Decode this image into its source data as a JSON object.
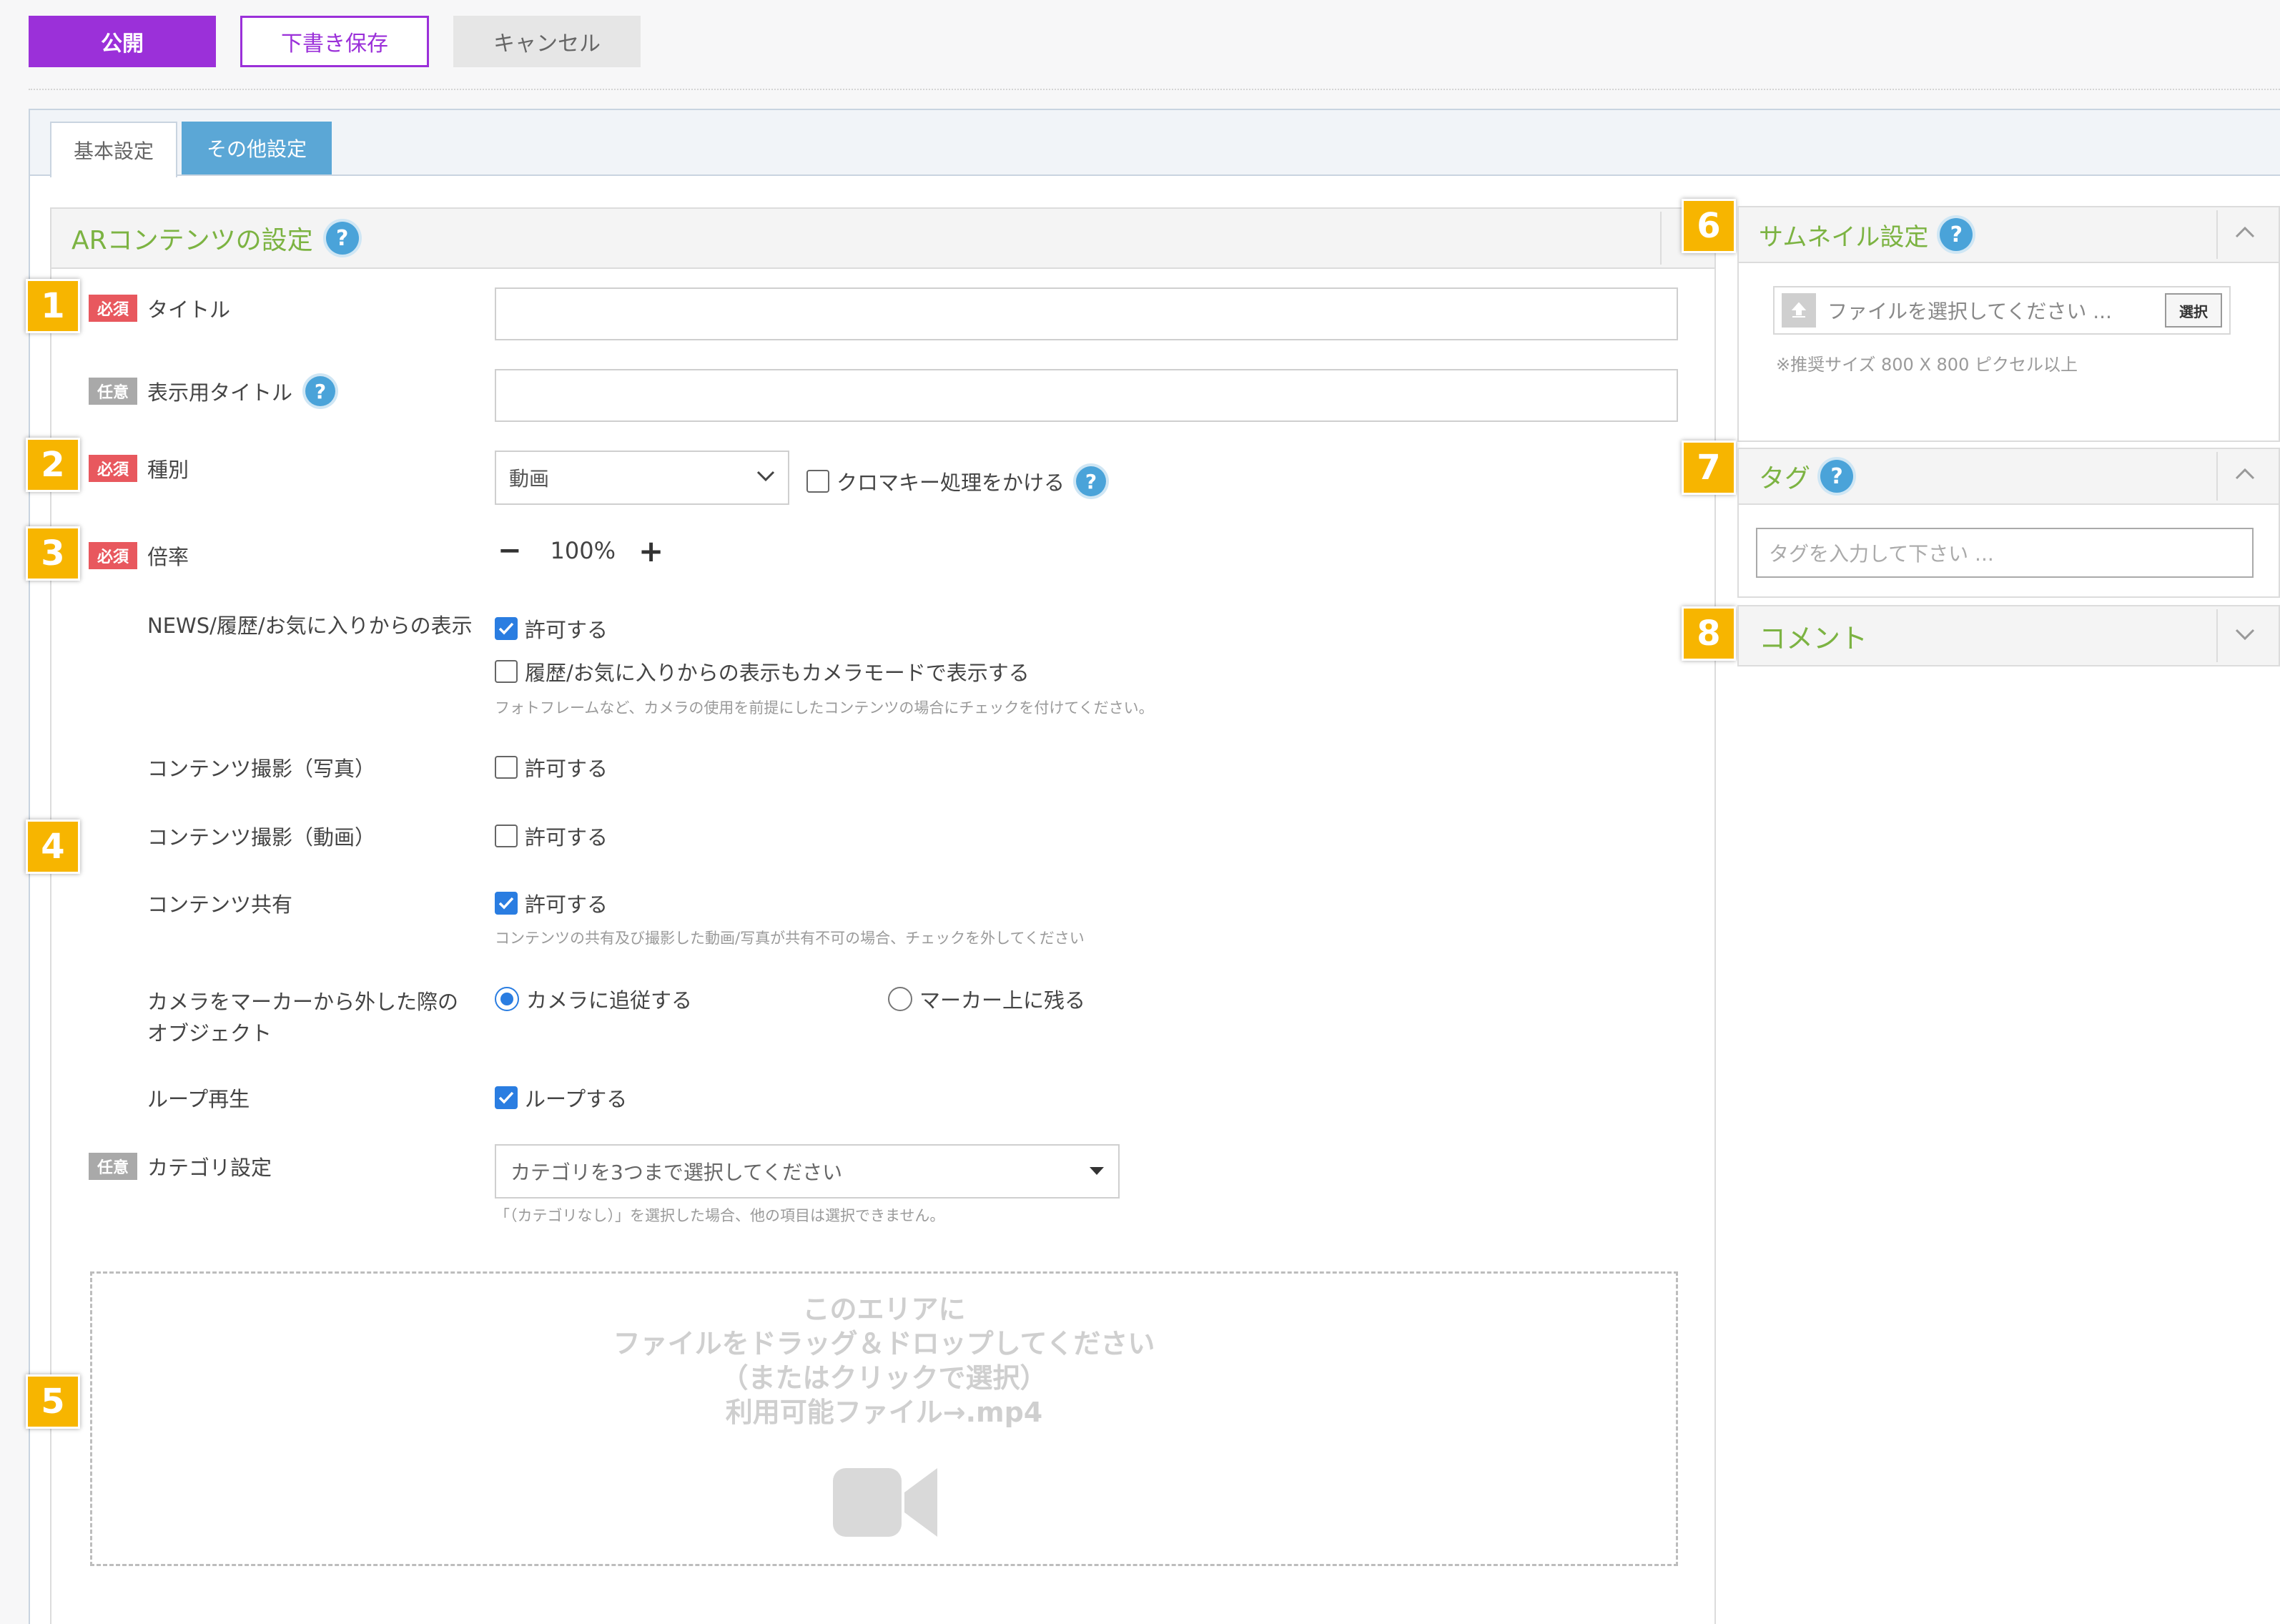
{
  "toolbar": {
    "publish_label": "公開",
    "draft_label": "下書き保存",
    "cancel_label": "キャンセル"
  },
  "tabs": [
    {
      "label": "基本設定",
      "active": true
    },
    {
      "label": "その他設定",
      "active": false
    }
  ],
  "main_panel": {
    "title": "ARコンテンツの設定",
    "help": "?"
  },
  "badges": {
    "required": "必須",
    "optional": "任意"
  },
  "markers": [
    "1",
    "2",
    "3",
    "4",
    "5",
    "6",
    "7",
    "8"
  ],
  "form": {
    "title_label": "タイトル",
    "title_value": "",
    "display_title_label": "表示用タイトル",
    "display_title_value": "",
    "type_label": "種別",
    "type_selected": "動画",
    "chroma_label": "クロマキー処理をかける",
    "chroma_checked": false,
    "scale_label": "倍率",
    "scale_minus": "−",
    "scale_value": "100%",
    "scale_plus": "+",
    "news_label": "NEWS/履歴/お気に入りからの表示",
    "news_allow_label": "許可する",
    "news_allow_checked": true,
    "news_camera_label": "履歴/お気に入りからの表示もカメラモードで表示する",
    "news_camera_checked": false,
    "news_note": "フォトフレームなど、カメラの使用を前提にしたコンテンツの場合にチェックを付けてください。",
    "photo_label": "コンテンツ撮影（写真）",
    "photo_allow_label": "許可する",
    "photo_checked": false,
    "video_label": "コンテンツ撮影（動画）",
    "video_allow_label": "許可する",
    "video_checked": false,
    "share_label": "コンテンツ共有",
    "share_allow_label": "許可する",
    "share_checked": true,
    "share_note": "コンテンツの共有及び撮影した動画/写真が共有不可の場合、チェックを外してください",
    "camera_label_line1": "カメラをマーカーから外した際の",
    "camera_label_line2": "オブジェクト",
    "camera_follow_label": "カメラに追従する",
    "camera_stay_label": "マーカー上に残る",
    "camera_selected": "follow",
    "loop_label": "ループ再生",
    "loop_option_label": "ループする",
    "loop_checked": true,
    "category_label": "カテゴリ設定",
    "category_placeholder": "カテゴリを3つまで選択してください",
    "category_note": "「（カテゴリなし）」を選択した場合、他の項目は選択できません。"
  },
  "dropzone": {
    "line1": "このエリアに",
    "line2": "ファイルをドラッグ＆ドロップしてください",
    "line3": "（またはクリックで選択）",
    "line4": "利用可能ファイル→.mp4",
    "icon": "video-camera-icon"
  },
  "sidebar": {
    "thumbnail": {
      "title": "サムネイル設定",
      "file_placeholder": "ファイルを選択してください ...",
      "select_button": "選択",
      "note": "※推奨サイズ 800 X 800 ピクセル以上",
      "collapsed": false
    },
    "tag": {
      "title": "タグ",
      "input_placeholder": "タグを入力して下さい ...",
      "collapsed": false
    },
    "comment": {
      "title": "コメント",
      "collapsed": true
    }
  },
  "colors": {
    "publish": "#9b30d9",
    "accent_green": "#7cb342",
    "help": "#4aa3d9",
    "required": "#e8585e",
    "optional": "#a9a9a9",
    "marker": "#f7b500",
    "tab_inactive": "#5ba7d6",
    "checkbox_on": "#2a7de1"
  }
}
